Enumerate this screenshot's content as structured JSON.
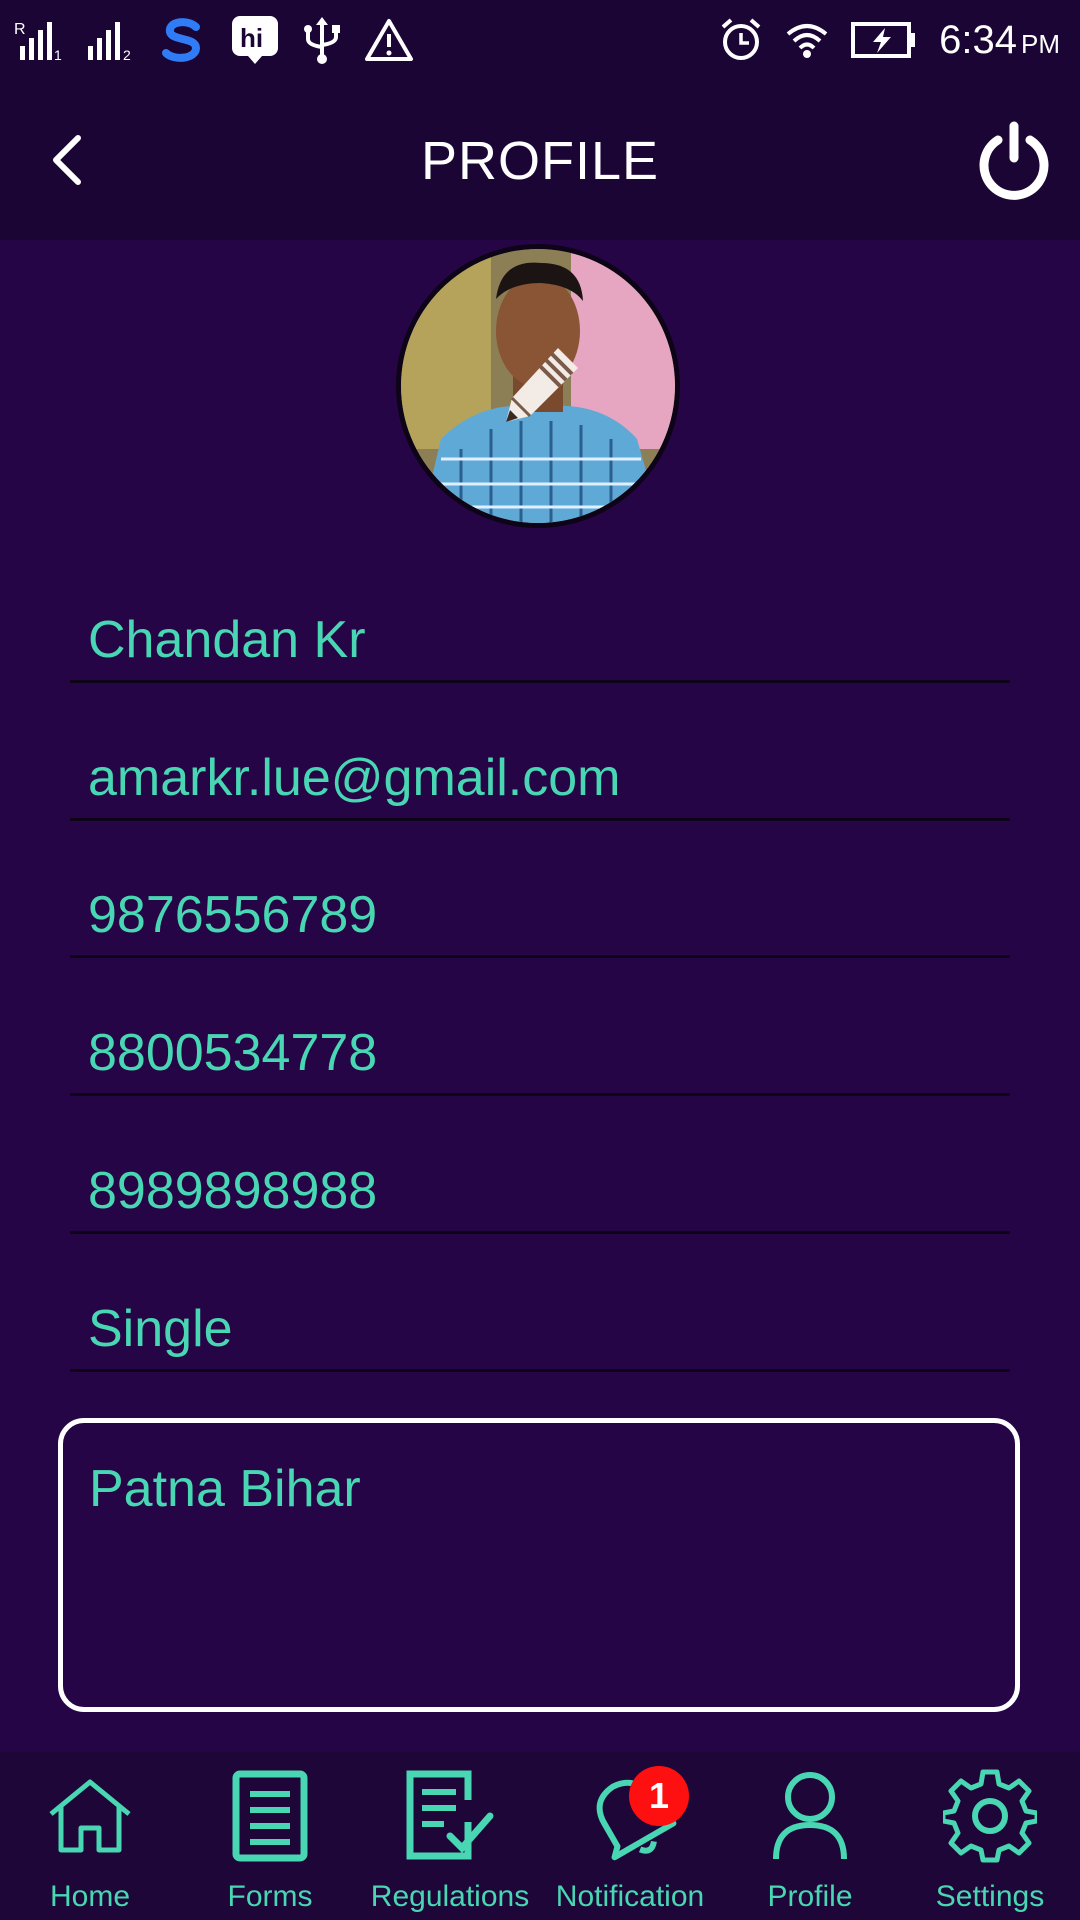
{
  "status_bar": {
    "time": "6:34",
    "ampm": "PM",
    "icons": [
      "signal-r-icon",
      "signal-2-icon",
      "s-app-icon",
      "hi-app-icon",
      "usb-icon",
      "warning-icon",
      "alarm-icon",
      "wifi-icon",
      "battery-charging-icon"
    ]
  },
  "app_bar": {
    "title": "PROFILE",
    "back_icon": "chevron-left-icon",
    "power_icon": "power-icon"
  },
  "profile": {
    "avatar_icon": "profile-photo",
    "edit_icon": "pencil-icon",
    "name": "Chandan Kr",
    "email": "amarkr.lue@gmail.com",
    "phone1": "9876556789",
    "phone2": "8800534778",
    "phone3": "8989898988",
    "marital_status": "Single",
    "address": "Patna Bihar"
  },
  "bottom_nav": {
    "items": [
      {
        "label": "Home",
        "icon": "home-icon"
      },
      {
        "label": "Forms",
        "icon": "document-icon"
      },
      {
        "label": "Regulations",
        "icon": "checklist-icon"
      },
      {
        "label": "Notification",
        "icon": "bell-icon",
        "badge": "1"
      },
      {
        "label": "Profile",
        "icon": "user-icon"
      },
      {
        "label": "Settings",
        "icon": "gear-icon"
      }
    ]
  },
  "colors": {
    "background": "#260546",
    "bar": "#1b0535",
    "accent": "#48d6b3",
    "badge": "#ff1010"
  }
}
